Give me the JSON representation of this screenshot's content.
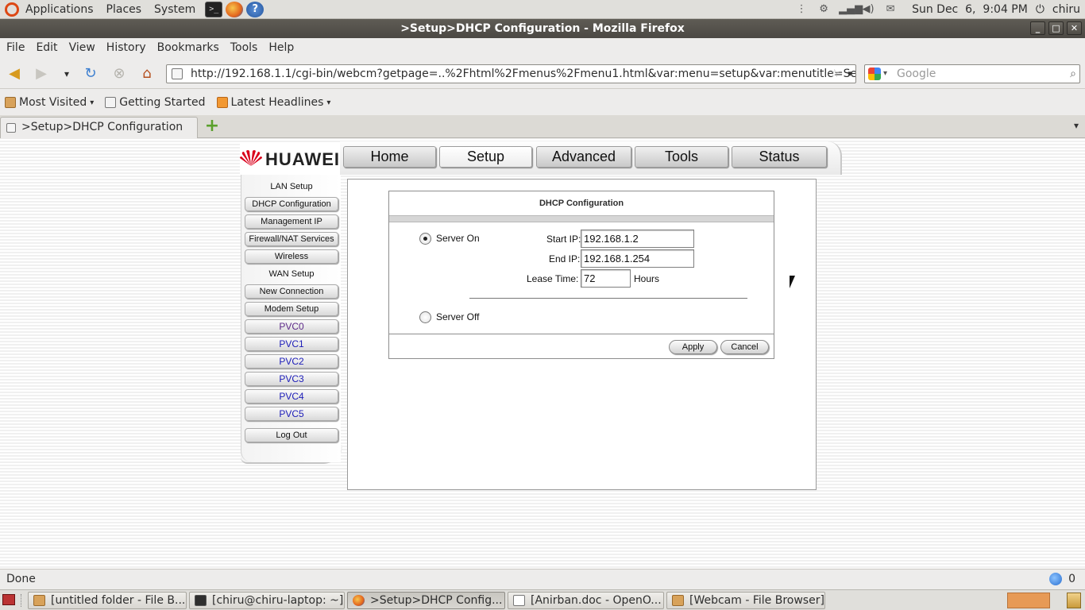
{
  "top_panel": {
    "menus": [
      "Applications",
      "Places",
      "System"
    ],
    "launchers": [
      "terminal-icon",
      "firefox-icon",
      "help-icon"
    ],
    "tray_icons": [
      "handle-icon",
      "network-icon",
      "signal-icon",
      "volume-icon",
      "mail-icon"
    ],
    "clock": "Sun Dec  6,  9:04 PM",
    "user": "chiru"
  },
  "window": {
    "title": ">Setup>DHCP Configuration - Mozilla Firefox",
    "controls": [
      "minimize-icon",
      "maximize-icon",
      "close-icon"
    ]
  },
  "menubar": {
    "items": [
      "File",
      "Edit",
      "View",
      "History",
      "Bookmarks",
      "Tools",
      "Help"
    ]
  },
  "navbar": {
    "url": "http://192.168.1.1/cgi-bin/webcm?getpage=..%2Fhtml%2Fmenus%2Fmenu1.html&var:menu=setup&var:menutitle=Setup",
    "search_placeholder": "Google"
  },
  "bookmarks": {
    "items": [
      "Most Visited",
      "Getting Started",
      "Latest Headlines"
    ]
  },
  "tabs": {
    "active": ">Setup>DHCP Configuration"
  },
  "router": {
    "brand": "HUAWEI",
    "brand_color": "#d9001b",
    "topnav": [
      "Home",
      "Setup",
      "Advanced",
      "Tools",
      "Status"
    ],
    "active_topnav": "Setup",
    "sidebar": {
      "lan_setup": "LAN Setup",
      "dhcp": "DHCP Configuration",
      "management_ip": "Management IP",
      "firewall": "Firewall/NAT Services",
      "wireless": "Wireless",
      "wan_setup": "WAN Setup",
      "new_connection": "New Connection",
      "modem_setup": "Modem Setup",
      "pvcs": [
        "PVC0",
        "PVC1",
        "PVC2",
        "PVC3",
        "PVC4",
        "PVC5"
      ],
      "logout": "Log Out"
    },
    "dhcp": {
      "title": "DHCP Configuration",
      "server_on": "Server On",
      "server_off": "Server Off",
      "selected_mode": "Server On",
      "start_ip_label": "Start IP:",
      "start_ip": "192.168.1.2",
      "end_ip_label": "End IP:",
      "end_ip": "192.168.1.254",
      "lease_label": "Lease Time:",
      "lease_value": "72",
      "lease_unit": "Hours",
      "apply": "Apply",
      "cancel": "Cancel"
    }
  },
  "statusbar": {
    "status": "Done",
    "count": "0"
  },
  "taskbar": {
    "tasks": [
      {
        "label": "[untitled folder - File B...",
        "icon": "folder-icon"
      },
      {
        "label": "[chiru@chiru-laptop: ~]",
        "icon": "terminal-icon"
      },
      {
        "label": ">Setup>DHCP Config...",
        "icon": "firefox-icon"
      },
      {
        "label": "[Anirban.doc - OpenO...",
        "icon": "document-icon"
      },
      {
        "label": "[Webcam - File Browser]",
        "icon": "folder-icon"
      }
    ]
  }
}
